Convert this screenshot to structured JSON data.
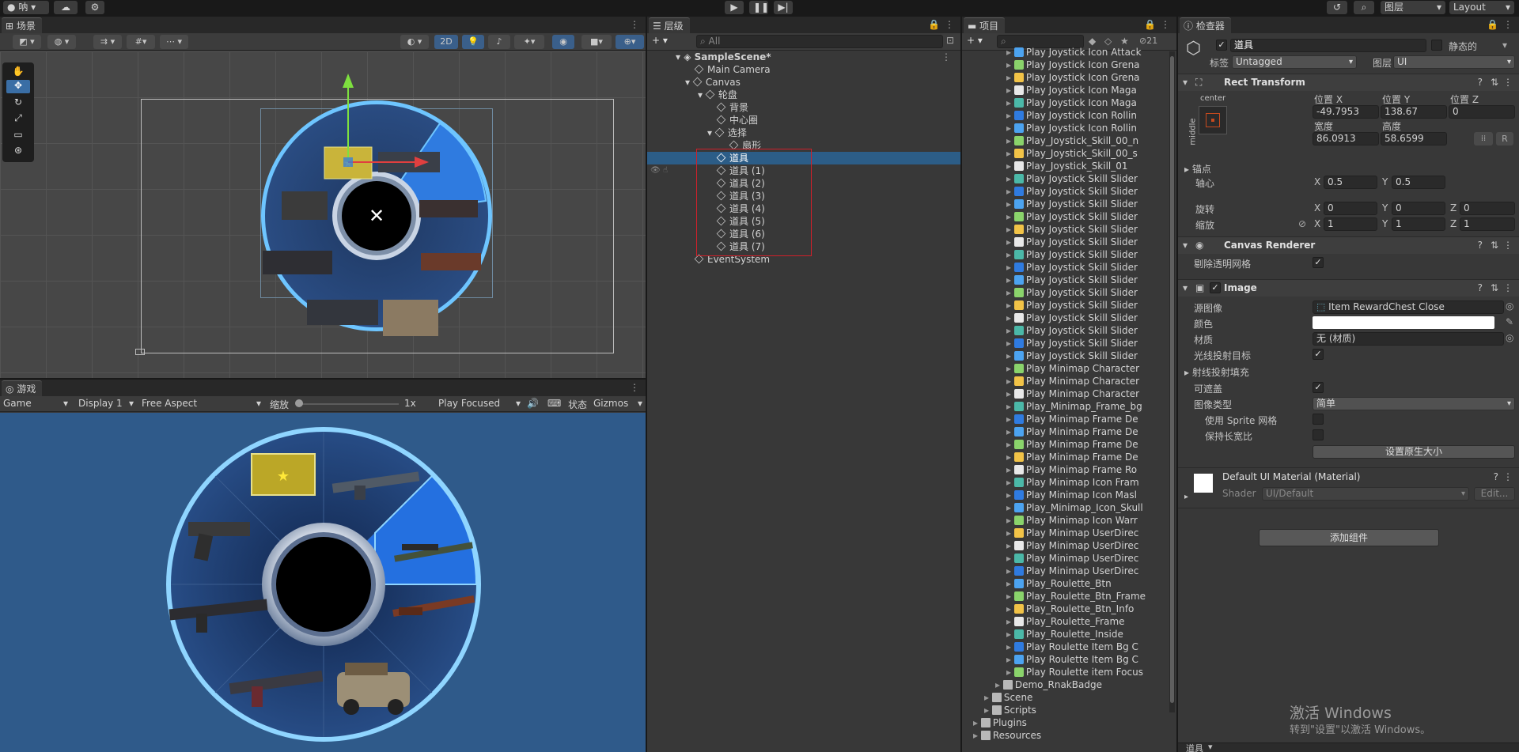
{
  "topbar": {
    "account": "呐",
    "cloud_icon": "cloud-icon",
    "services_icon": "gear-icon",
    "play_icon": "play-icon",
    "pause_icon": "pause-icon",
    "step_icon": "step-icon",
    "history_icon": "history-icon",
    "search_icon": "search-icon",
    "layers_label": "图层",
    "layout_label": "Layout"
  },
  "scene": {
    "tab": "场景",
    "toggle_2d": "2D"
  },
  "game": {
    "tab": "游戏",
    "mode": "Game",
    "display": "Display 1",
    "aspect": "Free Aspect",
    "scale_label": "缩放",
    "scale_value": "1x",
    "play_focused": "Play Focused",
    "stats": "状态",
    "gizmos": "Gizmos"
  },
  "hierarchy": {
    "tab": "层级",
    "search_placeholder": "All",
    "scene_name": "SampleScene*",
    "items": [
      {
        "label": "Main Camera"
      },
      {
        "label": "Canvas"
      },
      {
        "label": "轮盘"
      },
      {
        "label": "背景"
      },
      {
        "label": "中心圈"
      },
      {
        "label": "选择"
      },
      {
        "label": "扇形"
      },
      {
        "label": "道具"
      },
      {
        "label": "道具 (1)"
      },
      {
        "label": "道具 (2)"
      },
      {
        "label": "道具 (3)"
      },
      {
        "label": "道具 (4)"
      },
      {
        "label": "道具 (5)"
      },
      {
        "label": "道具 (6)"
      },
      {
        "label": "道具 (7)"
      },
      {
        "label": "EventSystem"
      }
    ]
  },
  "project": {
    "tab": "项目",
    "badge": "21",
    "assets": [
      "Play Joystick Icon Attack",
      "Play Joystick Icon Grena",
      "Play Joystick Icon Grena",
      "Play Joystick Icon Maga",
      "Play Joystick Icon Maga",
      "Play Joystick Icon Rollin",
      "Play Joystick Icon Rollin",
      "Play_Joystick_Skill_00_n",
      "Play_Joystick_Skill_00_s",
      "Play_Joystick_Skill_01",
      "Play Joystick Skill Slider",
      "Play Joystick Skill Slider",
      "Play Joystick Skill Slider",
      "Play Joystick Skill Slider",
      "Play Joystick Skill Slider",
      "Play Joystick Skill Slider",
      "Play Joystick Skill Slider",
      "Play Joystick Skill Slider",
      "Play Joystick Skill Slider",
      "Play Joystick Skill Slider",
      "Play Joystick Skill Slider",
      "Play Joystick Skill Slider",
      "Play Joystick Skill Slider",
      "Play Joystick Skill Slider",
      "Play Joystick Skill Slider",
      "Play Minimap Character",
      "Play Minimap Character",
      "Play Minimap Character",
      "Play_Minimap_Frame_bg",
      "Play Minimap Frame De",
      "Play Minimap Frame De",
      "Play Minimap Frame De",
      "Play Minimap Frame De",
      "Play Minimap Frame Ro",
      "Play Minimap Icon Fram",
      "Play Minimap Icon Masl",
      "Play_Minimap_Icon_Skull",
      "Play Minimap Icon Warr",
      "Play Minimap UserDirec",
      "Play Minimap UserDirec",
      "Play Minimap UserDirec",
      "Play Minimap UserDirec",
      "Play_Roulette_Btn",
      "Play_Roulette_Btn_Frame",
      "Play_Roulette_Btn_Info",
      "Play_Roulette_Frame",
      "Play_Roulette_Inside",
      "Play Roulette Item Bg C",
      "Play Roulette Item Bg C",
      "Play Roulette item Focus"
    ],
    "folders": [
      "Demo_RnakBadge",
      "Scene",
      "Scripts",
      "Plugins",
      "Resources"
    ]
  },
  "inspector": {
    "tab": "检查器",
    "object_name": "道具",
    "static_label": "静态的",
    "tag_label": "标签",
    "tag_value": "Untagged",
    "layer_label": "图层",
    "layer_value": "UI",
    "rect_transform": {
      "title": "Rect Transform",
      "anchor_h": "center",
      "anchor_v": "middle",
      "pos_x_label": "位置 X",
      "pos_y_label": "位置 Y",
      "pos_z_label": "位置 Z",
      "pos_x": "-49.7953",
      "pos_y": "138.67",
      "pos_z": "0",
      "width_label": "宽度",
      "height_label": "高度",
      "width": "86.0913",
      "height": "58.6599",
      "anchors_label": "锚点",
      "pivot_label": "轴心",
      "pivot_x": "0.5",
      "pivot_y": "0.5",
      "rotation_label": "旋转",
      "rot_x": "0",
      "rot_y": "0",
      "rot_z": "0",
      "scale_label": "缩放",
      "scale_x": "1",
      "scale_y": "1",
      "scale_z": "1",
      "x": "X",
      "y": "Y",
      "z": "Z",
      "r_btn": "R"
    },
    "canvas_renderer": {
      "title": "Canvas Renderer",
      "cull_label": "剔除透明网格"
    },
    "image": {
      "title": "Image",
      "source_label": "源图像",
      "source_value": "Item RewardChest Close",
      "color_label": "颜色",
      "material_label": "材质",
      "material_value": "无 (材质)",
      "raycast_label": "光线投射目标",
      "raycast_padding_label": "射线投射填充",
      "maskable_label": "可遮盖",
      "type_label": "图像类型",
      "type_value": "简单",
      "sprite_mesh_label": "使用 Sprite 网格",
      "preserve_label": "保持长宽比",
      "native_size_btn": "设置原生大小"
    },
    "material": {
      "title": "Default UI Material (Material)",
      "shader_label": "Shader",
      "shader_value": "UI/Default",
      "edit_btn": "Edit..."
    },
    "add_component": "添加组件",
    "footer_item": "道具"
  },
  "watermark": {
    "line1": "激活 Windows",
    "line2": "转到\"设置\"以激活 Windows。"
  },
  "colors": {
    "selection": "#2c5d87",
    "highlight_box": "#d0202a",
    "accent_blue": "#3a7fc8",
    "game_bg": "#2f5a8a"
  }
}
